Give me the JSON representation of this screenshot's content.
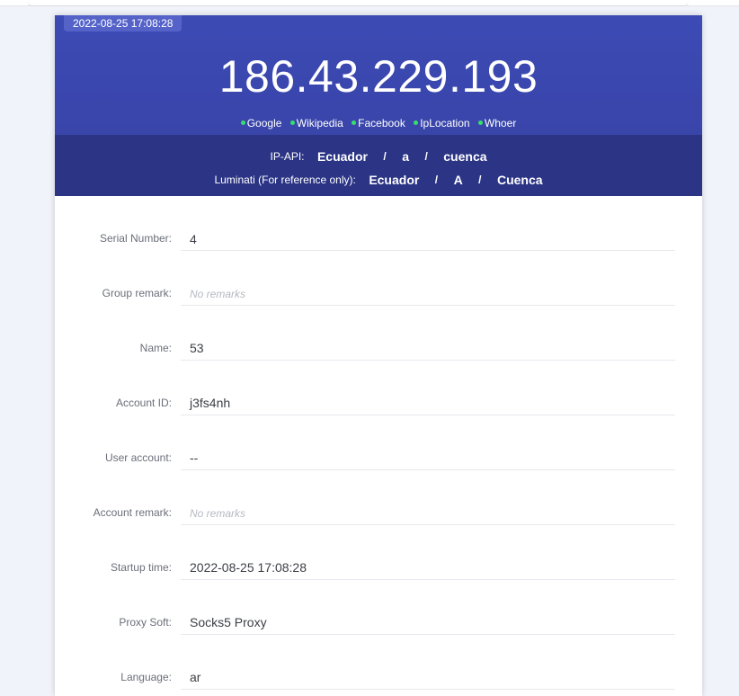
{
  "header": {
    "timestamp": "2022-08-25 17:08:28",
    "ip": "186.43.229.193",
    "links": [
      {
        "label": "Google"
      },
      {
        "label": "Wikipedia"
      },
      {
        "label": "Facebook"
      },
      {
        "label": "IpLocation"
      },
      {
        "label": "Whoer"
      }
    ]
  },
  "geo": {
    "ipapi": {
      "label": "IP-API:",
      "country": "Ecuador",
      "region": "a",
      "city": "cuenca"
    },
    "luminati": {
      "label": "Luminati (For reference only):",
      "country": "Ecuador",
      "region": "A",
      "city": "Cuenca"
    },
    "separator": "/"
  },
  "details": [
    {
      "label": "Serial Number:",
      "value": "4"
    },
    {
      "label": "Group remark:",
      "value": "No remarks",
      "placeholder": true
    },
    {
      "label": "Name:",
      "value": "53"
    },
    {
      "label": "Account ID:",
      "value": "j3fs4nh"
    },
    {
      "label": "User account:",
      "value": "--"
    },
    {
      "label": "Account remark:",
      "value": "No remarks",
      "placeholder": true
    },
    {
      "label": "Startup time:",
      "value": "2022-08-25 17:08:28"
    },
    {
      "label": "Proxy Soft:",
      "value": "Socks5 Proxy"
    },
    {
      "label": "Language:",
      "value": "ar"
    }
  ],
  "colors": {
    "hero": "#3d4bb5",
    "geo_band": "#2b3485",
    "status_dot": "#35e06a"
  }
}
